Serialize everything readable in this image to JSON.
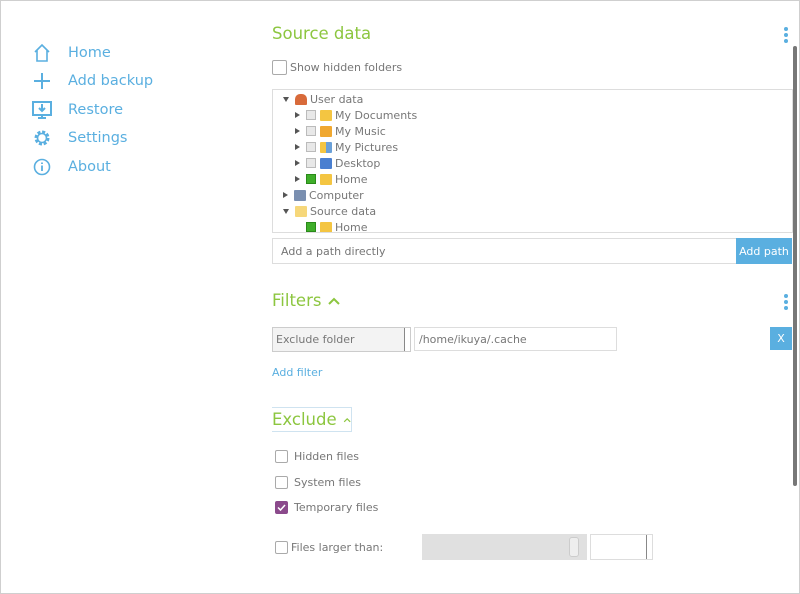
{
  "sidebar": {
    "items": [
      {
        "label": "Home",
        "icon": "home-icon"
      },
      {
        "label": "Add backup",
        "icon": "plus-icon"
      },
      {
        "label": "Restore",
        "icon": "restore-monitor-icon"
      },
      {
        "label": "Settings",
        "icon": "gear-icon"
      },
      {
        "label": "About",
        "icon": "info-icon"
      }
    ]
  },
  "source": {
    "title": "Source data",
    "show_hidden_label": "Show hidden folders",
    "show_hidden_checked": false,
    "tree": [
      {
        "label": "User data",
        "expanded": true,
        "level": 0
      },
      {
        "label": "My Documents",
        "level": 1,
        "checked": false
      },
      {
        "label": "My Music",
        "level": 1,
        "checked": false
      },
      {
        "label": "My Pictures",
        "level": 1,
        "checked": false
      },
      {
        "label": "Desktop",
        "level": 1,
        "checked": false
      },
      {
        "label": "Home",
        "level": 1,
        "checked": true
      },
      {
        "label": "Computer",
        "level": 0,
        "expanded": false
      },
      {
        "label": "Source data",
        "level": 0,
        "expanded": true
      },
      {
        "label": "Home",
        "level": 1,
        "checked": true
      }
    ],
    "path_placeholder": "Add a path directly",
    "add_path_label": "Add path"
  },
  "filters": {
    "title": "Filters",
    "filter_type": "Exclude folder",
    "filter_value": "/home/ikuya/.cache",
    "remove_label": "X",
    "add_filter_label": "Add filter"
  },
  "exclude": {
    "title": "Exclude",
    "options": [
      {
        "label": "Hidden files",
        "checked": false
      },
      {
        "label": "System files",
        "checked": false
      },
      {
        "label": "Temporary files",
        "checked": true
      }
    ],
    "larger_label": "Files larger than:",
    "larger_checked": false
  },
  "colors": {
    "accent": "#5aafe0",
    "heading": "#8cc63f",
    "checked": "#8b4a8c"
  }
}
